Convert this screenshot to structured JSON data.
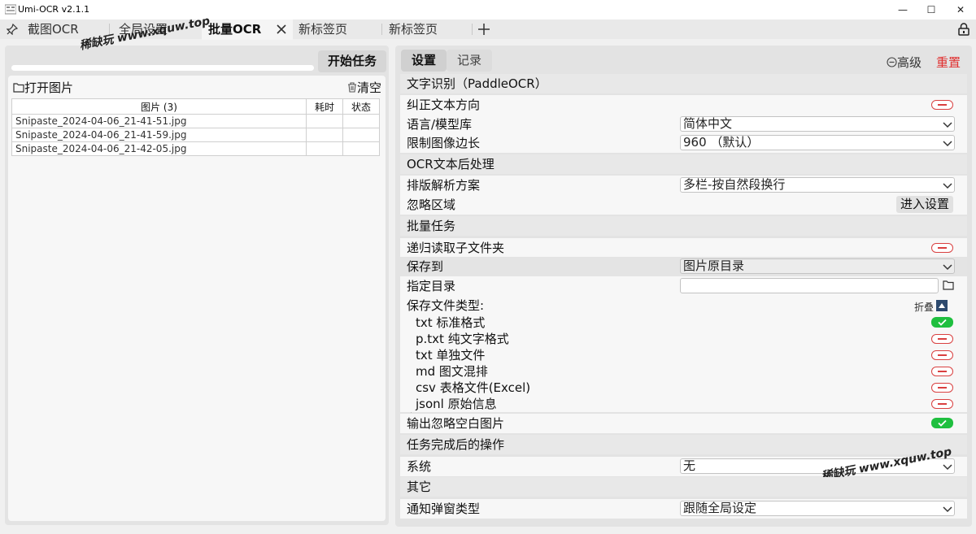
{
  "window": {
    "title": "Umi-OCR v2.1.1",
    "controls": [
      "—",
      "☐",
      "✕"
    ]
  },
  "tabs": [
    {
      "label": "截图OCR",
      "active": false
    },
    {
      "label": "全局设置",
      "active": false
    },
    {
      "label": "批量OCR",
      "active": true
    },
    {
      "label": "新标签页",
      "active": false
    },
    {
      "label": "新标签页",
      "active": false
    }
  ],
  "watermark": "稀缺玩 www.xquw.top",
  "left": {
    "start_button": "开始任务",
    "open_images": "打开图片",
    "clear": "清空",
    "table": {
      "headers": [
        "图片 (3)",
        "耗时",
        "状态"
      ],
      "rows": [
        [
          "Snipaste_2024-04-06_21-41-51.jpg",
          "",
          ""
        ],
        [
          "Snipaste_2024-04-06_21-41-59.jpg",
          "",
          ""
        ],
        [
          "Snipaste_2024-04-06_21-42-05.jpg",
          "",
          ""
        ]
      ]
    }
  },
  "right": {
    "tab_settings": "设置",
    "tab_records": "记录",
    "advanced": "高级",
    "reset": "重置",
    "sections": {
      "ocr": "文字识别（PaddleOCR）",
      "post": "OCR文本后处理",
      "batch": "批量任务",
      "after": "任务完成后的操作",
      "other": "其它"
    },
    "rows": {
      "correct_direction": "纠正文本方向",
      "language": "语言/模型库",
      "language_value": "简体中文",
      "limit_side": "限制图像边长",
      "limit_side_value": "960 （默认）",
      "layout": "排版解析方案",
      "layout_value": "多栏-按自然段换行",
      "ignore_area": "忽略区域",
      "ignore_area_btn": "进入设置",
      "recursive": "递归读取子文件夹",
      "save_to": "保存到",
      "save_to_value": "图片原目录",
      "dir": "指定目录",
      "save_types": "保存文件类型:",
      "fold": "折叠",
      "type_txt": "txt 标准格式",
      "type_ptxt": "p.txt 纯文字格式",
      "type_txt_single": "txt 单独文件",
      "type_md": "md 图文混排",
      "type_csv": "csv 表格文件(Excel)",
      "type_jsonl": "jsonl 原始信息",
      "ignore_blank": "输出忽略空白图片",
      "system": "系统",
      "system_value": "无",
      "notify": "通知弹窗类型",
      "notify_value": "跟随全局设定"
    }
  },
  "colors": {
    "toggle_on": "#1fbf3f",
    "toggle_off": "#d94040",
    "reset": "#e03030"
  }
}
